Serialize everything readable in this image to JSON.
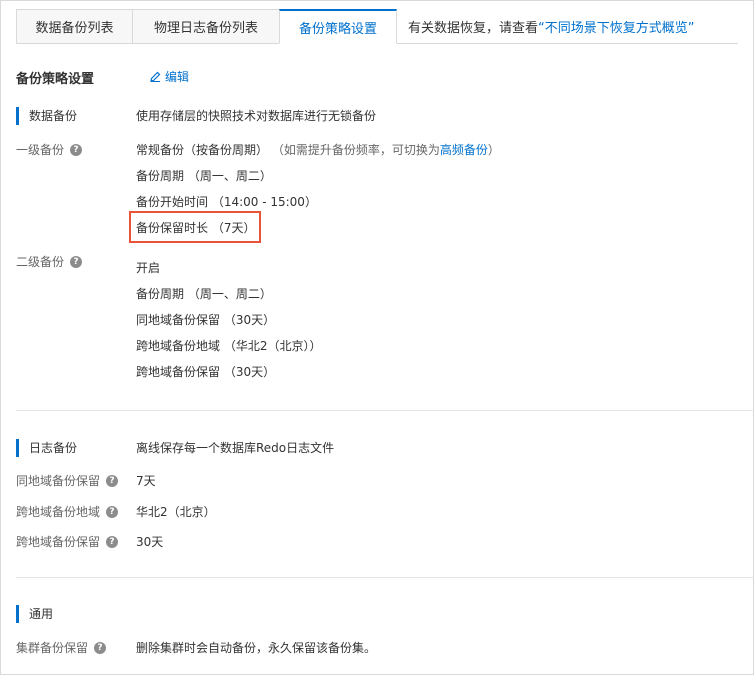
{
  "tabs": [
    {
      "label": "数据备份列表"
    },
    {
      "label": "物理日志备份列表"
    },
    {
      "label": "备份策略设置"
    }
  ],
  "tab_hint": {
    "prefix": "有关数据恢复，请查看",
    "link": "“不同场景下恢复方式概览”"
  },
  "header": {
    "title": "备份策略设置",
    "edit_label": "编辑"
  },
  "data_backup": {
    "section_label": "数据备份",
    "section_desc": "使用存储层的快照技术对数据库进行无锁备份",
    "level1": {
      "label": "一级备份",
      "mode": "常规备份（按备份周期）",
      "mode_note": "（如需提升备份频率，可切换为",
      "mode_link": "高频备份",
      "mode_note_end": "）",
      "cycle": "备份周期 （周一、周二）",
      "start_time": "备份开始时间 （14:00 - 15:00）",
      "retention": "备份保留时长 （7天）"
    },
    "level2": {
      "label": "二级备份",
      "status": "开启",
      "cycle": "备份周期 （周一、周二）",
      "same_region_retention": "同地域备份保留 （30天）",
      "cross_region": "跨地域备份地域 （华北2（北京））",
      "cross_region_retention": "跨地域备份保留 （30天）"
    }
  },
  "log_backup": {
    "section_label": "日志备份",
    "section_desc": "离线保存每一个数据库Redo日志文件",
    "same_region_label": "同地域备份保留",
    "same_region_value": "7天",
    "cross_region_label": "跨地域备份地域",
    "cross_region_value": "华北2（北京）",
    "cross_retention_label": "跨地域备份保留",
    "cross_retention_value": "30天"
  },
  "general": {
    "section_label": "通用",
    "cluster_label": "集群备份保留",
    "cluster_value": "删除集群时会自动备份，永久保留该备份集。"
  },
  "icons": {
    "help": "question-circle-icon",
    "edit": "pencil-icon"
  },
  "colors": {
    "accent": "#0070cc",
    "highlight": "#e8543a"
  }
}
